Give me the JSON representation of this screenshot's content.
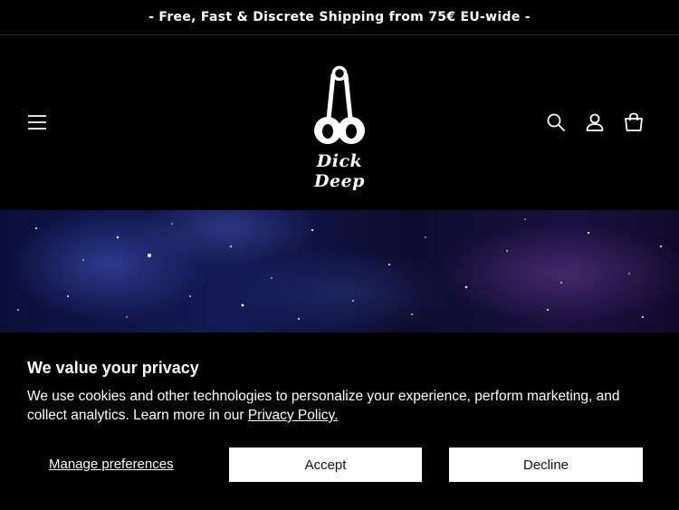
{
  "announcement": {
    "text": "- Free, Fast & Discrete Shipping from 75€ EU-wide -"
  },
  "header": {
    "brand_name": "Dick Deep",
    "icons": [
      "hamburger-menu-icon",
      "search-icon",
      "account-icon",
      "cart-icon"
    ]
  },
  "consent": {
    "title": "We value your privacy",
    "body_text": "We use cookies and other technologies to personalize your experience, perform marketing, and collect analytics. Learn more in our ",
    "policy_link": "Privacy Policy.",
    "manage_label": "Manage preferences",
    "accept_label": "Accept",
    "decline_label": "Decline"
  },
  "colors": {
    "background": "#000000",
    "text": "#ffffff",
    "button_bg": "#ffffff",
    "button_text": "#111111"
  }
}
